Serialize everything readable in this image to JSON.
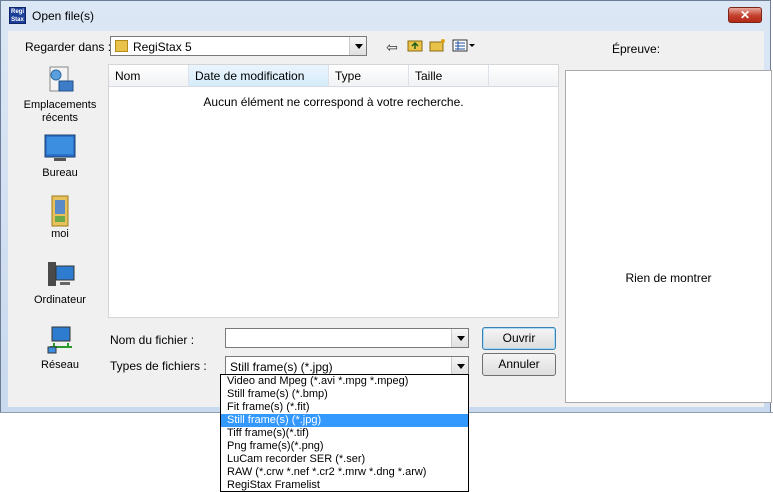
{
  "window": {
    "title": "Open file(s)",
    "close_glyph": "✕",
    "app_icon_text": "Regi Stax"
  },
  "lookin": {
    "label": "Regarder dans :",
    "value": "RegiStax 5"
  },
  "toolbar": {
    "back_icon": "back-arrow-icon",
    "up_icon": "up-folder-icon",
    "new_folder_icon": "new-folder-icon",
    "views_icon": "view-menu-icon"
  },
  "places": [
    {
      "label": "Emplacements récents",
      "icon": "recent-places-icon"
    },
    {
      "label": "Bureau",
      "icon": "desktop-icon"
    },
    {
      "label": "moi",
      "icon": "user-folder-icon"
    },
    {
      "label": "Ordinateur",
      "icon": "computer-icon"
    },
    {
      "label": "Réseau",
      "icon": "network-icon"
    }
  ],
  "list": {
    "columns": [
      "Nom",
      "Date de modification",
      "Type",
      "Taille"
    ],
    "empty_message": "Aucun élément ne correspond à votre recherche."
  },
  "preview": {
    "label": "Épreuve:",
    "empty_text": "Rien de montrer"
  },
  "filename": {
    "label": "Nom du fichier :",
    "value": ""
  },
  "filetype": {
    "label": "Types de fichiers :",
    "value": "Still frame(s) (*.jpg)",
    "options": [
      "Video and Mpeg (*.avi *.mpg *.mpeg)",
      "Still frame(s) (*.bmp)",
      "Fit frame(s) (*.fit)",
      "Still frame(s) (*.jpg)",
      "Tiff frame(s)(*.tif)",
      "Png frame(s)(*.png)",
      "LuCam recorder SER (*.ser)",
      "RAW (*.crw *.nef *.cr2 *.mrw *.dng *.arw)",
      "RegiStax Framelist"
    ],
    "selected_index": 3
  },
  "buttons": {
    "open": "Ouvrir",
    "cancel": "Annuler"
  },
  "colors": {
    "selection": "#3399ff",
    "close": "#c4402c"
  }
}
